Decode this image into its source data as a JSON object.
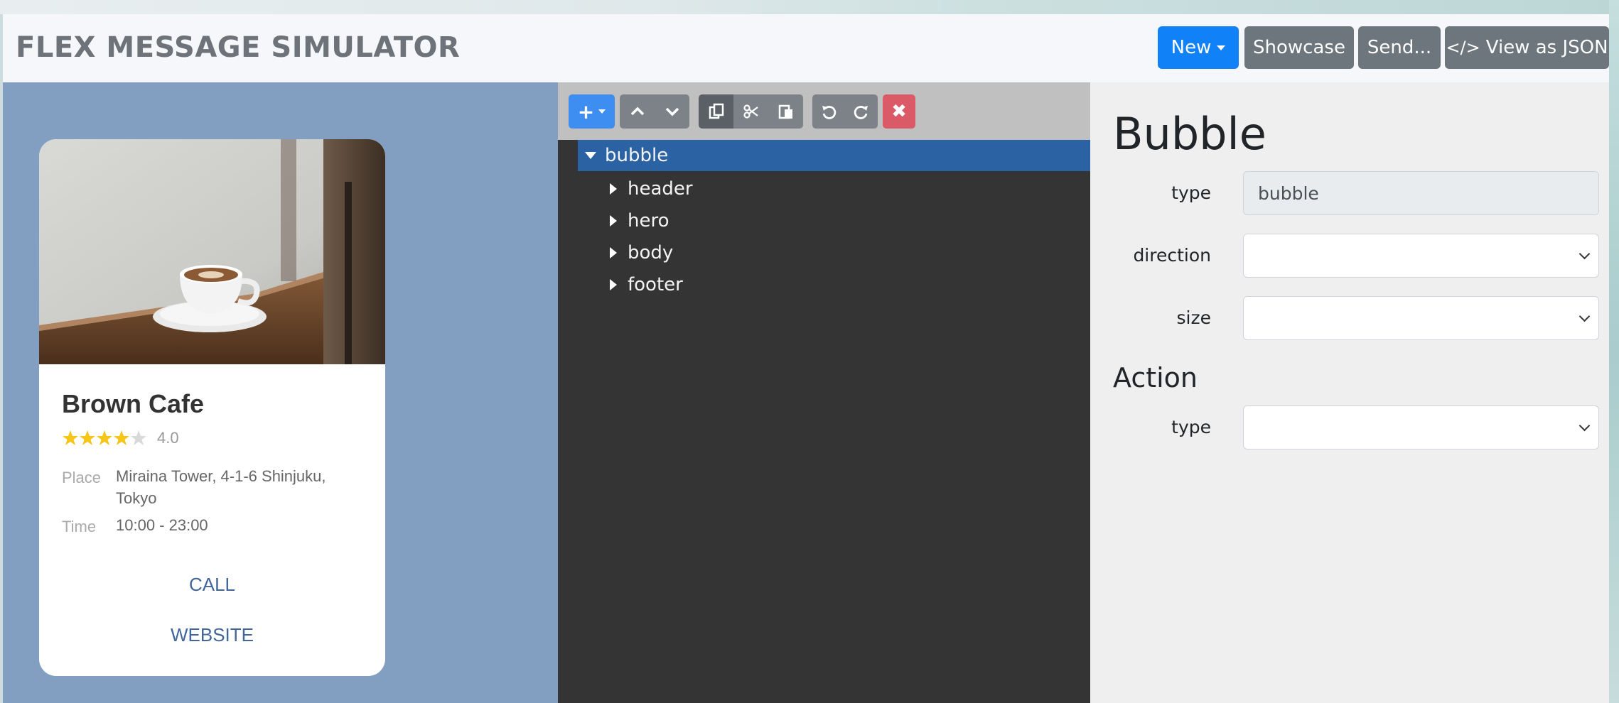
{
  "navbar": {
    "brand": "FLEX MESSAGE SIMULATOR",
    "new_label": "New",
    "showcase_label": "Showcase",
    "send_label": "Send...",
    "view_json_label": "View as JSON"
  },
  "preview": {
    "title": "Brown Cafe",
    "rating": {
      "stars_filled": 4,
      "stars_total": 5,
      "value": "4.0"
    },
    "place_label": "Place",
    "place_value": "Miraina Tower, 4-1-6 Shinjuku, Tokyo",
    "time_label": "Time",
    "time_value": "10:00 - 23:00",
    "call_label": "CALL",
    "website_label": "WEBSITE"
  },
  "tree": {
    "root": "bubble",
    "children": [
      "header",
      "hero",
      "body",
      "footer"
    ]
  },
  "props": {
    "title": "Bubble",
    "type_label": "type",
    "type_value": "bubble",
    "direction_label": "direction",
    "size_label": "size",
    "action_title": "Action",
    "action_type_label": "type"
  },
  "colors": {
    "primary": "#1181f7",
    "secondary": "#6d757d",
    "preview_bg": "#829fc1",
    "tree_bg": "#343434",
    "tree_selected": "#2a62a3",
    "danger": "#da5a68",
    "star": "#f5c518",
    "link": "#42659a"
  }
}
